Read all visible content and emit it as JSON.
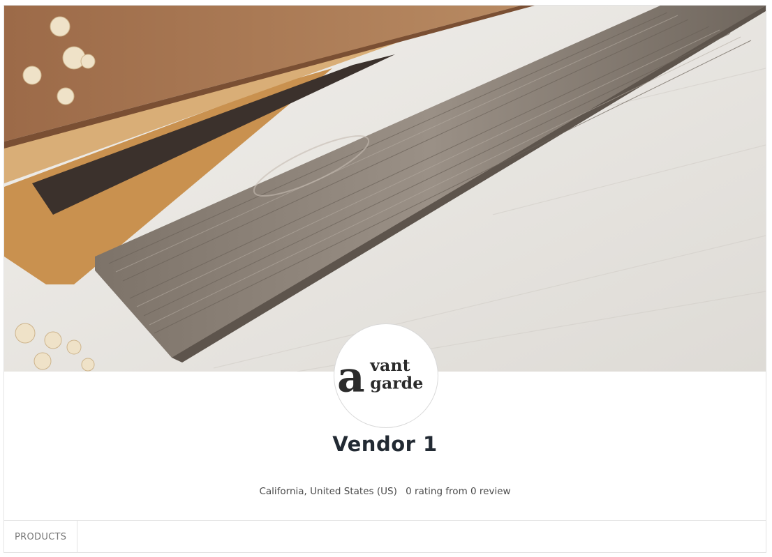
{
  "store": {
    "name": "Vendor 1",
    "location": "California, United States (US)",
    "rating_text": "0 rating from 0 review",
    "logo": {
      "icon": "avant-garde-logo",
      "letter": "a",
      "line1": "vant",
      "line2": "garde"
    },
    "banner_icon": "wood-planks-banner"
  },
  "tabs": [
    {
      "label": "PRODUCTS"
    }
  ]
}
